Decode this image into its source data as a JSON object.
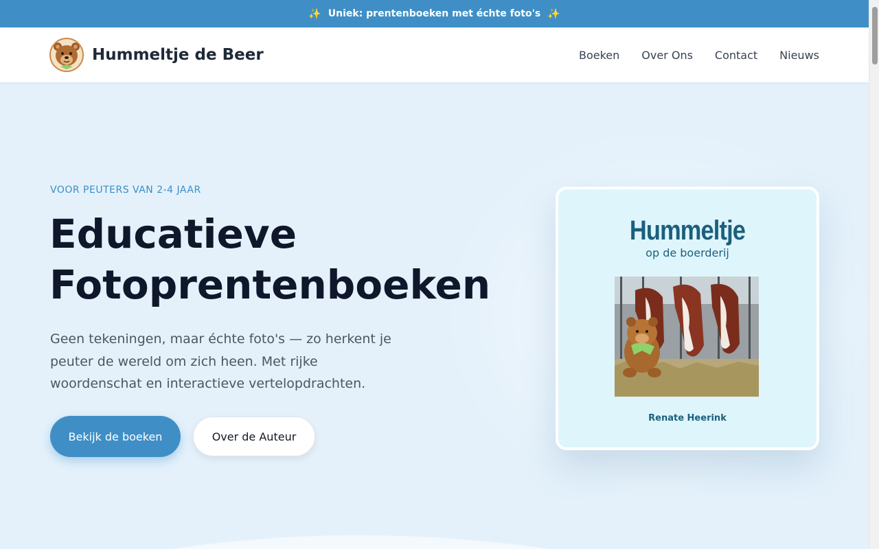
{
  "announcement": {
    "text": "Uniek: prentenboeken met échte foto's",
    "icon": "sparkles-icon"
  },
  "header": {
    "brand_name": "Hummeltje de Beer",
    "nav": [
      "Boeken",
      "Over Ons",
      "Contact",
      "Nieuws"
    ]
  },
  "hero": {
    "eyebrow": "VOOR PEUTERS VAN 2-4 JAAR",
    "headline_line1": "Educatieve",
    "headline_line2": "Fotoprentenboeken",
    "lede": "Geen tekeningen, maar échte foto's — zo herkent je peuter de wereld om zich heen. Met rijke woordenschat en interactieve vertelopdrachten.",
    "primary_button": "Bekijk de boeken",
    "secondary_button": "Over de Auteur"
  },
  "book": {
    "title": "Hummeltje",
    "subtitle": "op de boerderij",
    "author": "Renate Heerink"
  },
  "colors": {
    "accent": "#3f8fc6",
    "background": "#e4f1fb",
    "book_bg": "#dff5fc",
    "book_text": "#1b5f7d"
  }
}
